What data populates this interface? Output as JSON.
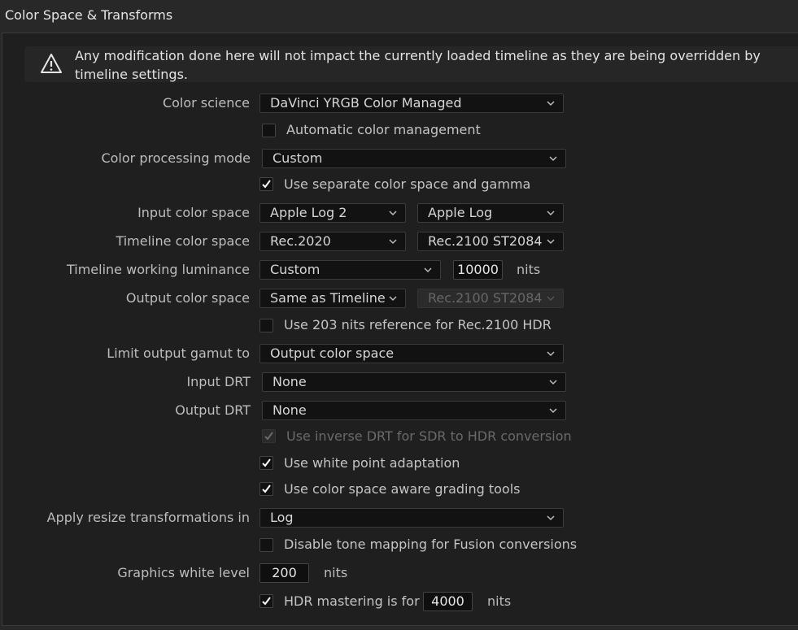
{
  "header": {
    "title": "Color Space & Transforms"
  },
  "warning": {
    "text": "Any modification done here will not impact the currently loaded timeline as they are being overridden by timeline settings."
  },
  "labels": {
    "color_science": "Color science",
    "color_processing_mode": "Color processing mode",
    "input_color_space": "Input color space",
    "timeline_color_space": "Timeline color space",
    "timeline_working_luminance": "Timeline working luminance",
    "output_color_space": "Output color space",
    "limit_output_gamut": "Limit output gamut to",
    "input_drt": "Input DRT",
    "output_drt": "Output DRT",
    "apply_resize": "Apply resize transformations in",
    "graphics_white_level": "Graphics white level"
  },
  "values": {
    "color_science": "DaVinci YRGB Color Managed",
    "color_processing_mode": "Custom",
    "input_color_space": "Apple Log 2",
    "input_gamma": "Apple Log",
    "timeline_color_space": "Rec.2020",
    "timeline_gamma": "Rec.2100 ST2084",
    "timeline_working_luminance": "Custom",
    "luminance_nits": "10000",
    "output_color_space": "Same as Timeline",
    "output_gamma": "Rec.2100 ST2084",
    "limit_output_gamut": "Output color space",
    "input_drt": "None",
    "output_drt": "None",
    "apply_resize": "Log",
    "graphics_white_level": "200",
    "hdr_mastering": "4000"
  },
  "units": {
    "nits": "nits"
  },
  "checkboxes": {
    "automatic_color_management": {
      "label": "Automatic color management",
      "checked": false
    },
    "separate_color_space_gamma": {
      "label": "Use separate color space and gamma",
      "checked": true
    },
    "use_203_nits": {
      "label": "Use 203 nits reference for Rec.2100 HDR",
      "checked": false
    },
    "inverse_drt": {
      "label": "Use inverse DRT for SDR to HDR conversion",
      "checked": true,
      "disabled": true
    },
    "white_point_adaptation": {
      "label": "Use white point adaptation",
      "checked": true
    },
    "color_space_aware_tools": {
      "label": "Use color space aware grading tools",
      "checked": true
    },
    "disable_tone_mapping": {
      "label": "Disable tone mapping for Fusion conversions",
      "checked": false
    },
    "hdr_mastering": {
      "label": "HDR mastering is for",
      "checked": true
    }
  },
  "icons": {
    "warning": "warning-icon",
    "chevron": "chevron-down-icon",
    "check": "checkmark-icon"
  },
  "colors": {
    "background": "#1f1f1f",
    "field": "#121212",
    "text": "#c9c9c9"
  }
}
